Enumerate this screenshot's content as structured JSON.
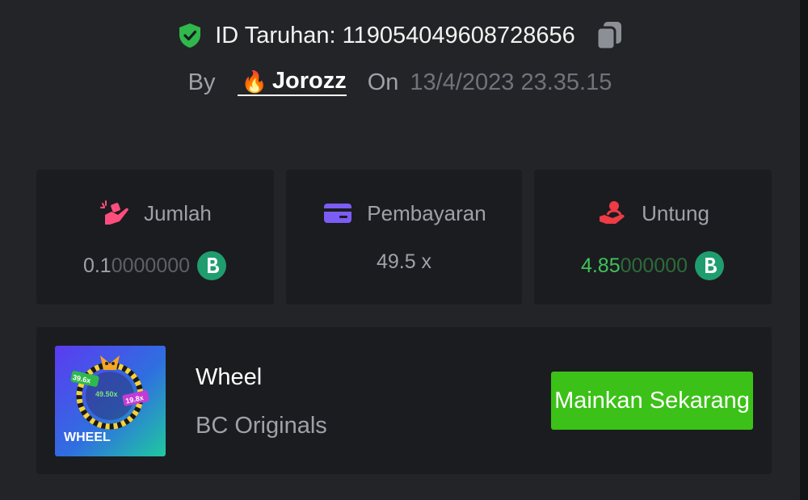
{
  "bet": {
    "id_label": "ID Taruhan: 119054049608728656",
    "by_label": "By",
    "user": "Jorozz",
    "on_label": "On",
    "date": "13/4/2023 23.35.15"
  },
  "stats": [
    {
      "label": "Jumlah",
      "value_main": "0.1",
      "value_tail": "0000000",
      "icon": "bet-hand-icon",
      "color": "#ff4e7e"
    },
    {
      "label": "Pembayaran",
      "value": "49.5 x",
      "icon": "card-icon",
      "color": "#7b5cf5"
    },
    {
      "label": "Untung",
      "value_main": "4.85",
      "value_tail": "000000",
      "icon": "profit-hand-icon",
      "color": "#ee3b45"
    }
  ],
  "game": {
    "thumb_text": "WHEEL",
    "thumb_mult_1": "39.6x",
    "thumb_mult_2": "49.50x",
    "thumb_mult_3": "19.8x",
    "name": "Wheel",
    "provider": "BC Originals",
    "play_label": "Mainkan Sekarang"
  },
  "colors": {
    "accent_green": "#3bc117",
    "profit_green": "#3ec25a",
    "coin": "#1f9d6e"
  }
}
